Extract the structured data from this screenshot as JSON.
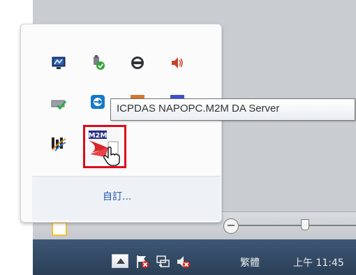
{
  "tray_popup": {
    "icons": [
      {
        "name": "network-monitor-icon"
      },
      {
        "name": "safely-remove-hardware-icon"
      },
      {
        "name": "gamepad-icon"
      },
      {
        "name": "speaker-volume-icon"
      },
      {
        "name": "card-reader-check-icon"
      },
      {
        "name": "teamviewer-icon"
      },
      {
        "name": "orange-app-icon"
      },
      {
        "name": "blue-app-icon"
      },
      {
        "name": "rain-meter-icon"
      },
      {
        "name": "m2m-da-server-icon"
      }
    ],
    "tooltip": "ICPDAS NAPOPC.M2M DA Server",
    "m2m_label": "M2M",
    "customize_label": "自訂..."
  },
  "colors": {
    "highlight_frame": "#e0071a",
    "link": "#1e5aa8",
    "taskbar": "#2b3f57"
  },
  "status_bar": {
    "zoom_minus": "−"
  },
  "taskbar": {
    "tray": {
      "show_hidden_icons": "show-hidden-icons-button",
      "icons": [
        "action-center-flag-icon",
        "network-icon",
        "volume-muted-icon"
      ],
      "language_label": "繁體",
      "clock": "上午 11:45"
    }
  }
}
